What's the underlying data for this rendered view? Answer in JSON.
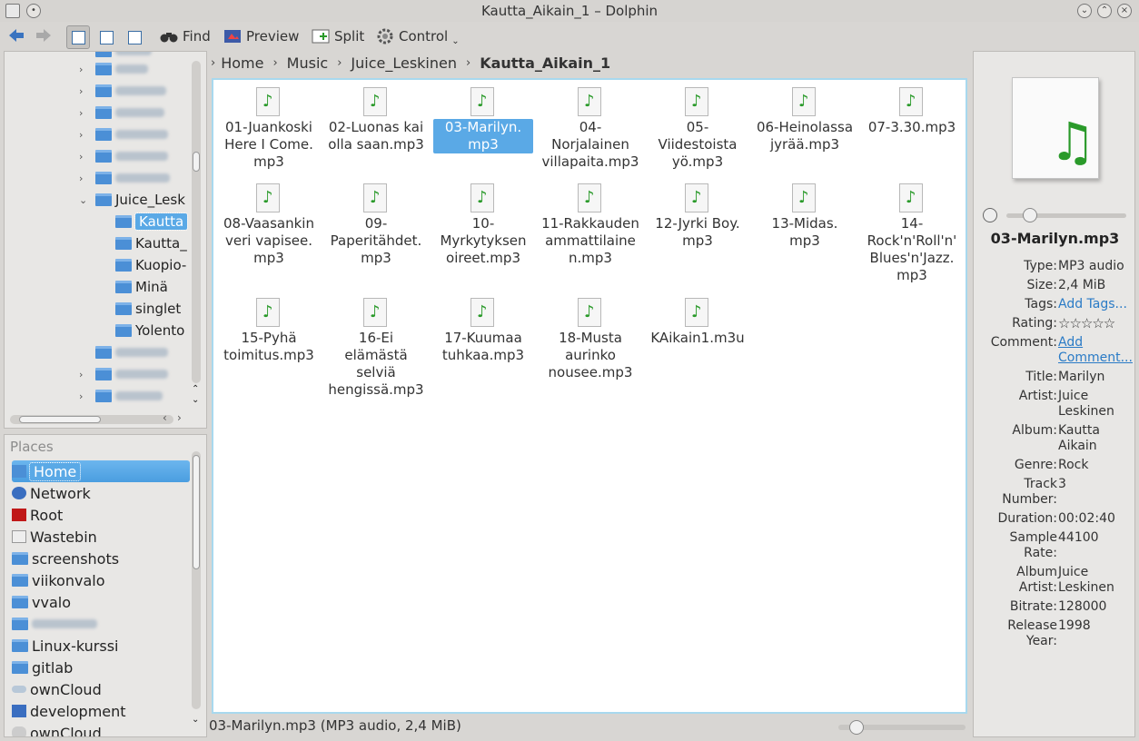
{
  "window": {
    "title": "Kautta_Aikain_1 – Dolphin"
  },
  "toolbar": {
    "find": "Find",
    "preview": "Preview",
    "split": "Split",
    "control": "Control"
  },
  "tree": {
    "items": [
      {
        "label": "Juice_Lesk"
      },
      {
        "label": "Kautta"
      },
      {
        "label": "Kautta_"
      },
      {
        "label": "Kuopio-"
      },
      {
        "label": "Minä"
      },
      {
        "label": "singlet"
      },
      {
        "label": "Yolento"
      }
    ]
  },
  "places": {
    "title": "Places",
    "items": [
      {
        "label": "Home"
      },
      {
        "label": "Network"
      },
      {
        "label": "Root"
      },
      {
        "label": "Wastebin"
      },
      {
        "label": "screenshots"
      },
      {
        "label": "viikonvalo"
      },
      {
        "label": "vvalo"
      },
      {
        "label": "Linux-kurssi"
      },
      {
        "label": "gitlab"
      },
      {
        "label": "ownCloud"
      },
      {
        "label": "development"
      },
      {
        "label": "ownCloud"
      }
    ]
  },
  "breadcrumb": {
    "items": [
      "Home",
      "Music",
      "Juice_Leskinen"
    ],
    "current": "Kautta_Aikain_1"
  },
  "files": [
    {
      "name": "01-Juankoski Here I Come. mp3"
    },
    {
      "name": "02-Luonas kai olla saan.mp3"
    },
    {
      "name": "03-Marilyn. mp3"
    },
    {
      "name": "04-Norjalainen villapaita.mp3"
    },
    {
      "name": "05-Viidestoista yö.mp3"
    },
    {
      "name": "06-Heinolassa jyrää.mp3"
    },
    {
      "name": "07-3.30.mp3"
    },
    {
      "name": "08-Vaasankin veri vapisee. mp3"
    },
    {
      "name": "09-Paperitähdet. mp3"
    },
    {
      "name": "10-Myrkytyksen oireet.mp3"
    },
    {
      "name": "11-Rakkauden ammattilaine n.mp3"
    },
    {
      "name": "12-Jyrki Boy. mp3"
    },
    {
      "name": "13-Midas. mp3"
    },
    {
      "name": "14-Rock'n'Roll'n' Blues'n'Jazz. mp3"
    },
    {
      "name": "15-Pyhä toimitus.mp3"
    },
    {
      "name": "16-Ei elämästä selviä hengissä.mp3"
    },
    {
      "name": "17-Kuumaa tuhkaa.mp3"
    },
    {
      "name": "18-Musta aurinko nousee.mp3"
    },
    {
      "name": "KAikain1.m3u"
    }
  ],
  "status": {
    "text": "03-Marilyn.mp3 (MP3 audio, 2,4 MiB)"
  },
  "info": {
    "name": "03-Marilyn.mp3",
    "rows": [
      {
        "key": "Type:",
        "value": "MP3 audio"
      },
      {
        "key": "Size:",
        "value": "2,4 MiB"
      },
      {
        "key": "Tags:",
        "value": "Add Tags..."
      },
      {
        "key": "Rating:",
        "value": "☆☆☆☆☆"
      },
      {
        "key": "Comment:",
        "value": "Add Comment..."
      },
      {
        "key": "Title:",
        "value": "Marilyn"
      },
      {
        "key": "Artist:",
        "value": "Juice Leskinen"
      },
      {
        "key": "Album:",
        "value": "Kautta Aikain"
      },
      {
        "key": "Genre:",
        "value": "Rock"
      },
      {
        "key": "Track Number:",
        "value": "3"
      },
      {
        "key": "Duration:",
        "value": "00:02:40"
      },
      {
        "key": "Sample Rate:",
        "value": "44100"
      },
      {
        "key": "Album Artist:",
        "value": "Juice Leskinen"
      },
      {
        "key": "Bitrate:",
        "value": "128000"
      },
      {
        "key": "Release Year:",
        "value": "1998"
      }
    ]
  },
  "colors": {
    "selection": "#5aa9e6",
    "folder": "#4b8fd6",
    "note": "#2a9a2a",
    "link": "#2a7bc6"
  }
}
